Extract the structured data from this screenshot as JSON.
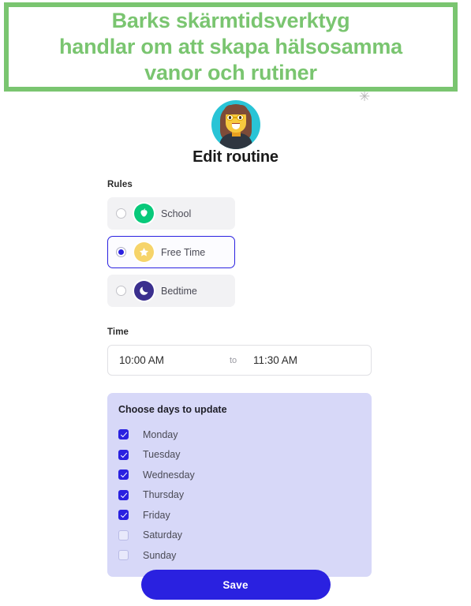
{
  "banner": {
    "text": "Barks skärmtidsverktyg\nhandlar om att skapa hälsosamma\nvanor och rutiner",
    "border_color": "#7ac570",
    "text_color": "#7ac570"
  },
  "watermark": {
    "glyph": "✳"
  },
  "avatar": {
    "name": "woman-with-glasses-avatar",
    "background_color": "#29c4d6"
  },
  "page": {
    "title": "Edit routine",
    "accent_color": "#2a21e0"
  },
  "rules": {
    "label": "Rules",
    "options": [
      {
        "label": "School",
        "icon": "apple-icon",
        "icon_color": "#08c97a",
        "selected": false
      },
      {
        "label": "Free Time",
        "icon": "star-icon",
        "icon_color": "#f6d46a",
        "selected": true
      },
      {
        "label": "Bedtime",
        "icon": "moon-icon",
        "icon_color": "#3b2f8e",
        "selected": false
      }
    ]
  },
  "time": {
    "label": "Time",
    "start": "10:00 AM",
    "separator": "to",
    "end": "11:30 AM"
  },
  "days": {
    "title": "Choose days to update",
    "panel_color": "#d7d8f8",
    "items": [
      {
        "label": "Monday",
        "checked": true
      },
      {
        "label": "Tuesday",
        "checked": true
      },
      {
        "label": "Wednesday",
        "checked": true
      },
      {
        "label": "Thursday",
        "checked": true
      },
      {
        "label": "Friday",
        "checked": true
      },
      {
        "label": "Saturday",
        "checked": false
      },
      {
        "label": "Sunday",
        "checked": false
      }
    ]
  },
  "footer": {
    "save_label": "Save"
  }
}
